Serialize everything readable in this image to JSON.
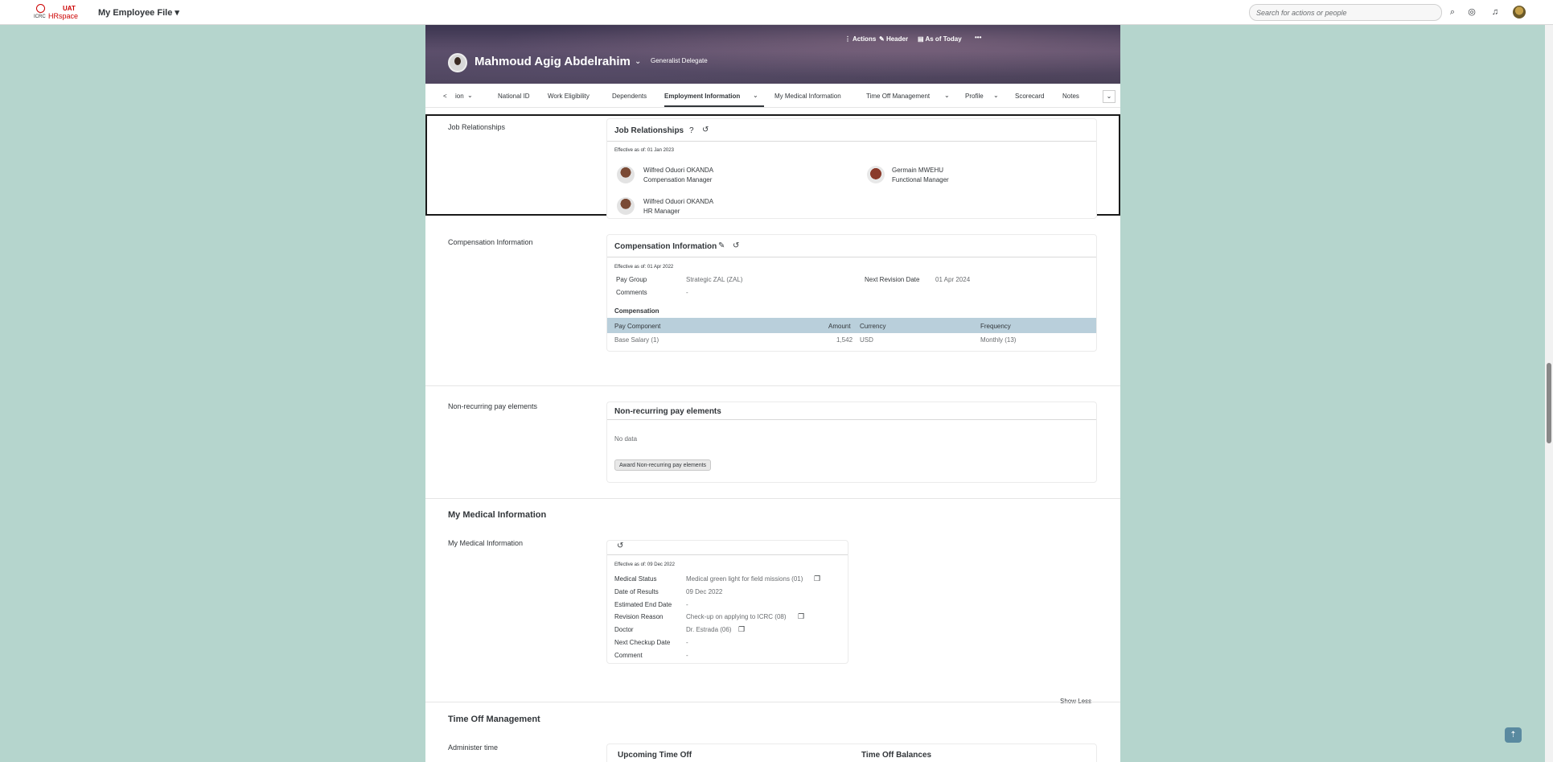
{
  "shell": {
    "logo_icrc": "ICRC",
    "logo_uat": "UAT",
    "logo_hr": "HRspace",
    "app_title": "My Employee File ▾",
    "search_placeholder": "Search for actions or people"
  },
  "header": {
    "actions": "Actions",
    "header_btn": "Header",
    "as_of": "As of Today",
    "more": "•••",
    "employee_name": "Mahmoud Agig Abdelrahim",
    "employee_title": "Generalist Delegate"
  },
  "tabs": {
    "prev": "<",
    "t0": "ion",
    "t1": "National ID",
    "t2": "Work Eligibility",
    "t3": "Dependents",
    "t4": "Employment Information",
    "t5": "My Medical Information",
    "t6": "Time Off Management",
    "t7": "Profile",
    "t8": "Scorecard",
    "t9": "Notes",
    "more": "⌄"
  },
  "job_relationships": {
    "label": "Job Relationships",
    "title": "Job Relationships",
    "effective": "Effective as of: 01 Jan 2023",
    "p1_name": "Wilfred Oduori OKANDA",
    "p1_role": "Compensation Manager",
    "p2_name": "Germain MWEHU",
    "p2_role": "Functional Manager",
    "p3_name": "Wilfred Oduori OKANDA",
    "p3_role": "HR Manager"
  },
  "compensation": {
    "label": "Compensation Information",
    "title": "Compensation Information",
    "effective": "Effective as of: 01 Apr 2022",
    "pay_group_label": "Pay Group",
    "pay_group_value": "Strategic ZAL (ZAL)",
    "next_revision_label": "Next Revision Date",
    "next_revision_value": "01 Apr 2024",
    "comments_label": "Comments",
    "comments_value": "-",
    "sub_title": "Compensation",
    "col_component": "Pay Component",
    "col_amount": "Amount",
    "col_currency": "Currency",
    "col_frequency": "Frequency",
    "row_component": "Base Salary (1)",
    "row_amount": "1,542",
    "row_currency": "USD",
    "row_frequency": "Monthly (13)"
  },
  "nonrecurring": {
    "label": "Non-recurring pay elements",
    "title": "Non-recurring pay elements",
    "no_data": "No data",
    "award_btn": "Award Non-recurring pay elements"
  },
  "medical": {
    "group_title": "My Medical Information",
    "label": "My Medical Information",
    "effective": "Effective as of: 09 Dec 2022",
    "status_label": "Medical Status",
    "status_value": "Medical green light for field missions (01)",
    "results_label": "Date of Results",
    "results_value": "09 Dec 2022",
    "end_label": "Estimated End Date",
    "end_value": "-",
    "reason_label": "Revision Reason",
    "reason_value": "Check-up on applying to ICRC (08)",
    "doctor_label": "Doctor",
    "doctor_value": "Dr. Estrada (06)",
    "checkup_label": "Next Checkup Date",
    "checkup_value": "-",
    "comment_label": "Comment",
    "comment_value": "-",
    "show_less": "Show Less"
  },
  "time_off": {
    "group_title": "Time Off Management",
    "label": "Administer time",
    "upcoming": "Upcoming Time Off",
    "balances": "Time Off Balances"
  }
}
